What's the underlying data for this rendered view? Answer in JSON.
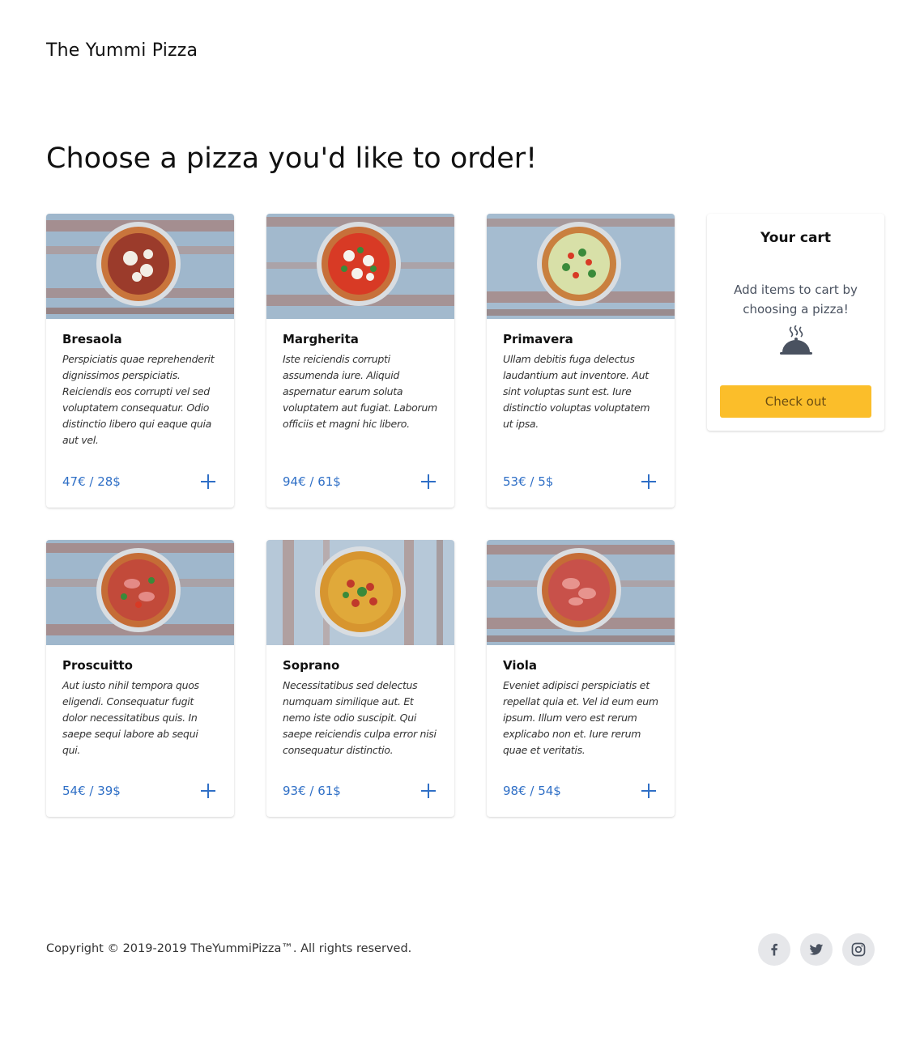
{
  "header": {
    "brand": "The Yummi Pizza"
  },
  "main": {
    "headline": "Choose a pizza you'd like to order!",
    "pizzas": [
      {
        "name": "Bresaola",
        "description": "Perspiciatis quae reprehenderit dignissimos perspiciatis. Reiciendis eos corrupti vel sed voluptatem consequatur. Odio distinctio libero qui eaque quia aut vel.",
        "price": "47€ / 28$",
        "add_icon": "plus-icon"
      },
      {
        "name": "Margherita",
        "description": "Iste reiciendis corrupti assumenda iure. Aliquid aspernatur earum soluta voluptatem aut fugiat. Laborum officiis et magni hic libero.",
        "price": "94€ / 61$",
        "add_icon": "plus-icon"
      },
      {
        "name": "Primavera",
        "description": "Ullam debitis fuga delectus laudantium aut inventore. Aut sint voluptas sunt est. Iure distinctio voluptas voluptatem ut ipsa.",
        "price": "53€ / 5$",
        "add_icon": "plus-icon"
      },
      {
        "name": "Proscuitto",
        "description": "Aut iusto nihil tempora quos eligendi. Consequatur fugit dolor necessitatibus quis. In saepe sequi labore ab sequi qui.",
        "price": "54€ / 39$",
        "add_icon": "plus-icon"
      },
      {
        "name": "Soprano",
        "description": "Necessitatibus sed delectus numquam similique aut. Et nemo iste odio suscipit. Qui saepe reiciendis culpa error nisi consequatur distinctio.",
        "price": "93€ / 61$",
        "add_icon": "plus-icon"
      },
      {
        "name": "Viola",
        "description": "Eveniet adipisci perspiciatis et repellat quia et. Vel id eum eum ipsum. Illum vero est rerum explicabo non et. Iure rerum quae et veritatis.",
        "price": "98€ / 54$",
        "add_icon": "plus-icon"
      }
    ]
  },
  "cart": {
    "title": "Your cart",
    "empty_hint": "Add items to cart by choosing a pizza!",
    "icon": "cloche-icon",
    "checkout_label": "Check out"
  },
  "footer": {
    "copyright": "Copyright © 2019-2019 TheYummiPizza™. All rights reserved.",
    "social": [
      {
        "icon": "facebook-icon"
      },
      {
        "icon": "twitter-icon"
      },
      {
        "icon": "instagram-icon"
      }
    ]
  },
  "colors": {
    "accent": "#2f6fc6",
    "checkout": "#fbbe2a",
    "social_bg": "#e6e7ea"
  }
}
